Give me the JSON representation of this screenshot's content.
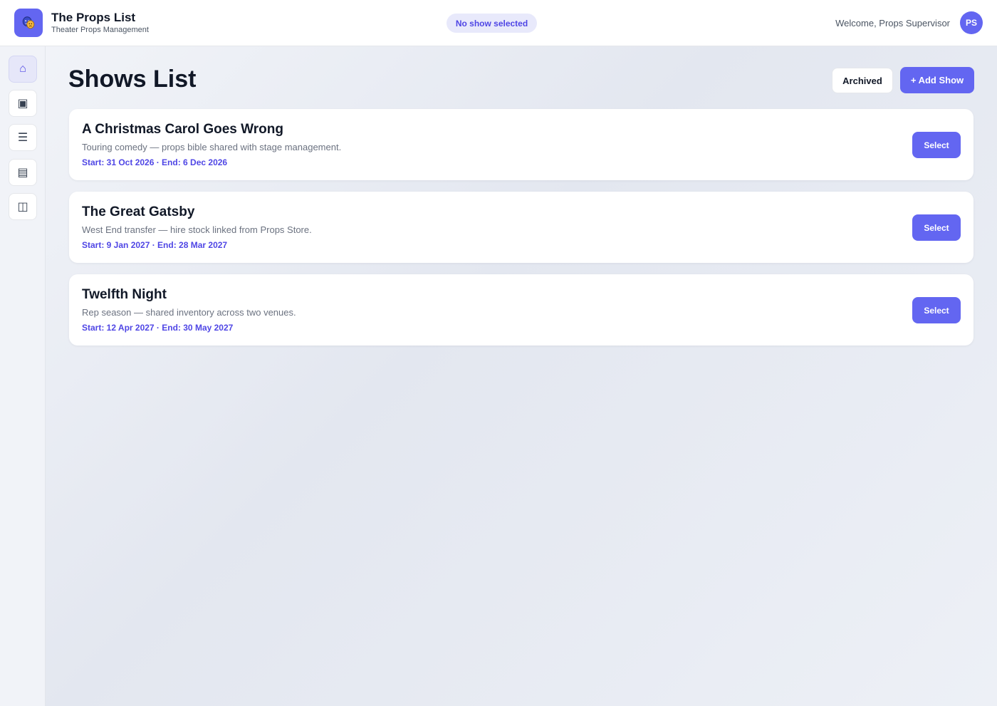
{
  "header": {
    "app_title": "The Props List",
    "app_subtitle": "Theater Props Management",
    "logo_icon": "theater-masks-icon",
    "show_status": "No show selected",
    "welcome_text": "Welcome, Props Supervisor",
    "avatar_initials": "PS"
  },
  "sidebar": {
    "items": [
      {
        "icon": "home-icon",
        "glyph": "⌂",
        "active": true
      },
      {
        "icon": "shows-icon",
        "glyph": "▣",
        "active": false
      },
      {
        "icon": "list-icon",
        "glyph": "☰",
        "active": false
      },
      {
        "icon": "inventory-icon",
        "glyph": "▤",
        "active": false
      },
      {
        "icon": "columns-icon",
        "glyph": "◫",
        "active": false
      }
    ]
  },
  "main": {
    "page_title": "Shows List",
    "archived_label": "Archived",
    "add_show_label": "+ Add Show",
    "shows": [
      {
        "title": "A Christmas Carol Goes Wrong",
        "description": "Touring comedy — props bible shared with stage management.",
        "dates": "Start: 31 Oct 2026 · End: 6 Dec 2026",
        "select_label": "Select"
      },
      {
        "title": "The Great Gatsby",
        "description": "West End transfer — hire stock linked from Props Store.",
        "dates": "Start: 9 Jan 2027 · End: 28 Mar 2027",
        "select_label": "Select"
      },
      {
        "title": "Twelfth Night",
        "description": "Rep season — shared inventory across two venues.",
        "dates": "Start: 12 Apr 2027 · End: 30 May 2027",
        "select_label": "Select"
      }
    ]
  },
  "colors": {
    "accent": "#6366f1",
    "accent_text": "#4f46e5",
    "pill_bg": "#e8e9fb"
  }
}
